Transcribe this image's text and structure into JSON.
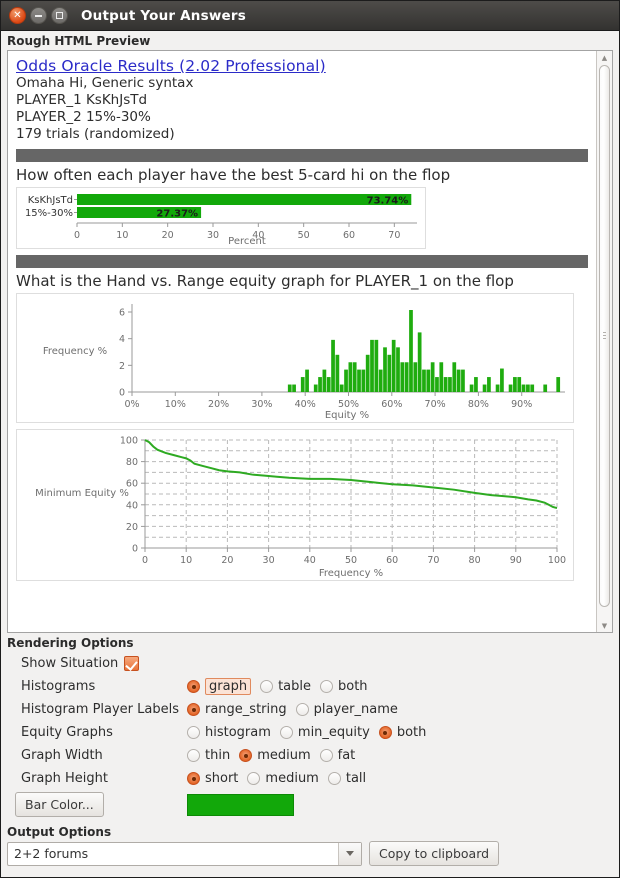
{
  "window": {
    "title": "Output Your Answers",
    "controls": {
      "close": "close-button",
      "minimize": "minimize-button",
      "maximize": "maximize-button"
    }
  },
  "preview": {
    "group_label": "Rough HTML Preview",
    "link_title": "Odds Oracle Results (2.02 Professional)",
    "lines": [
      "Omaha Hi, Generic syntax",
      "PLAYER_1 KsKhJsTd",
      "PLAYER_2 15%-30%",
      "179 trials (randomized)"
    ],
    "question_1": "How often each player have the best 5-card hi on the flop",
    "question_2": "What is the Hand vs. Range equity graph for PLAYER_1 on the flop"
  },
  "options": {
    "group_label": "Rendering Options",
    "rows": [
      {
        "label": "Show Situation",
        "type": "checkbox",
        "checked": true
      },
      {
        "label": "Histograms",
        "type": "radio",
        "selected": "graph",
        "focused": "graph",
        "choices": [
          "graph",
          "table",
          "both"
        ]
      },
      {
        "label": "Histogram Player Labels",
        "type": "radio",
        "selected": "range_string",
        "choices": [
          "range_string",
          "player_name"
        ]
      },
      {
        "label": "Equity Graphs",
        "type": "radio",
        "selected": "both",
        "choices": [
          "histogram",
          "min_equity",
          "both"
        ]
      },
      {
        "label": "Graph Width",
        "type": "radio",
        "selected": "medium",
        "choices": [
          "thin",
          "medium",
          "fat"
        ]
      },
      {
        "label": "Graph Height",
        "type": "radio",
        "selected": "short",
        "choices": [
          "short",
          "medium",
          "tall"
        ]
      }
    ],
    "bar_color_button": "Bar Color...",
    "bar_color_value": "#12a80a"
  },
  "output": {
    "group_label": "Output Options",
    "format_value": "2+2 forums",
    "copy_button": "Copy to clipboard"
  },
  "chart_data": [
    {
      "type": "bar",
      "orientation": "horizontal",
      "title": "How often each player have the best 5-card hi on the flop",
      "categories": [
        "KsKhJsTd",
        "15%-30%"
      ],
      "values": [
        73.74,
        27.37
      ],
      "data_labels": [
        "73.74%",
        "27.37%"
      ],
      "xlabel": "Percent",
      "ylabel": "",
      "xticks": [
        0,
        10,
        20,
        30,
        40,
        50,
        60,
        70
      ],
      "xlim": [
        0,
        75
      ],
      "grid": false,
      "color": "#12a80a"
    },
    {
      "type": "bar",
      "title": "Hand vs. Range equity histogram for PLAYER_1 on the flop",
      "xlabel": "Equity %",
      "ylabel": "Frequency %",
      "xticks": [
        "0%",
        "10%",
        "20%",
        "30%",
        "40%",
        "50%",
        "60%",
        "70%",
        "80%",
        "90%"
      ],
      "xtick_values": [
        0,
        10,
        20,
        30,
        40,
        50,
        60,
        70,
        80,
        90
      ],
      "yticks": [
        0,
        2,
        4,
        6
      ],
      "xlim": [
        0,
        100
      ],
      "ylim": [
        0,
        6.6
      ],
      "grid": false,
      "color": "#1fac0f",
      "bin_width": 1,
      "x": [
        36,
        37,
        39,
        40,
        41,
        42,
        43,
        44,
        45,
        46,
        47,
        48,
        49,
        50,
        51,
        52,
        53,
        54,
        55,
        56,
        57,
        58,
        59,
        60,
        61,
        62,
        63,
        64,
        65,
        66,
        67,
        68,
        69,
        70,
        71,
        72,
        73,
        74,
        75,
        76,
        78,
        79,
        81,
        82,
        84,
        85,
        87,
        88,
        89,
        90,
        91,
        92,
        93,
        95,
        98
      ],
      "values": [
        0.56,
        0.56,
        1.12,
        1.68,
        0.0,
        0.56,
        1.12,
        1.68,
        1.12,
        3.91,
        2.79,
        0.56,
        1.68,
        2.23,
        2.23,
        1.68,
        1.68,
        2.79,
        3.91,
        3.91,
        1.68,
        3.35,
        2.79,
        3.91,
        3.35,
        2.23,
        2.23,
        6.15,
        2.23,
        4.47,
        1.68,
        1.68,
        2.23,
        1.12,
        2.23,
        1.12,
        1.12,
        2.23,
        1.68,
        1.68,
        0.56,
        1.12,
        0.56,
        1.12,
        0.56,
        1.76,
        0.56,
        1.12,
        1.12,
        0.56,
        0.56,
        0.56,
        0.0,
        0.56,
        1.12
      ]
    },
    {
      "type": "line",
      "title": "Minimum equity curve for PLAYER_1 on the flop",
      "xlabel": "Frequency %",
      "ylabel": "Minimum Equity %",
      "xticks": [
        0,
        10,
        20,
        30,
        40,
        50,
        60,
        70,
        80,
        90,
        100
      ],
      "yticks": [
        0,
        20,
        40,
        60,
        80,
        100
      ],
      "xlim": [
        0,
        100
      ],
      "ylim": [
        0,
        100
      ],
      "grid": true,
      "color": "#2eaa22",
      "x": [
        0,
        1,
        2,
        3,
        5,
        7,
        9,
        10,
        11,
        12,
        14,
        16,
        18,
        20,
        23,
        26,
        29,
        32,
        35,
        40,
        45,
        50,
        55,
        60,
        65,
        70,
        75,
        80,
        84,
        87,
        90,
        93,
        95,
        97,
        98,
        99,
        100
      ],
      "values": [
        100,
        98,
        94,
        91,
        88,
        86,
        84,
        83,
        81,
        78,
        76,
        74,
        72,
        71,
        70,
        68,
        67,
        66,
        65,
        64,
        64,
        63,
        61,
        59,
        58,
        56,
        54,
        51,
        49,
        48,
        47,
        45,
        44,
        42,
        40,
        38,
        37
      ]
    }
  ]
}
